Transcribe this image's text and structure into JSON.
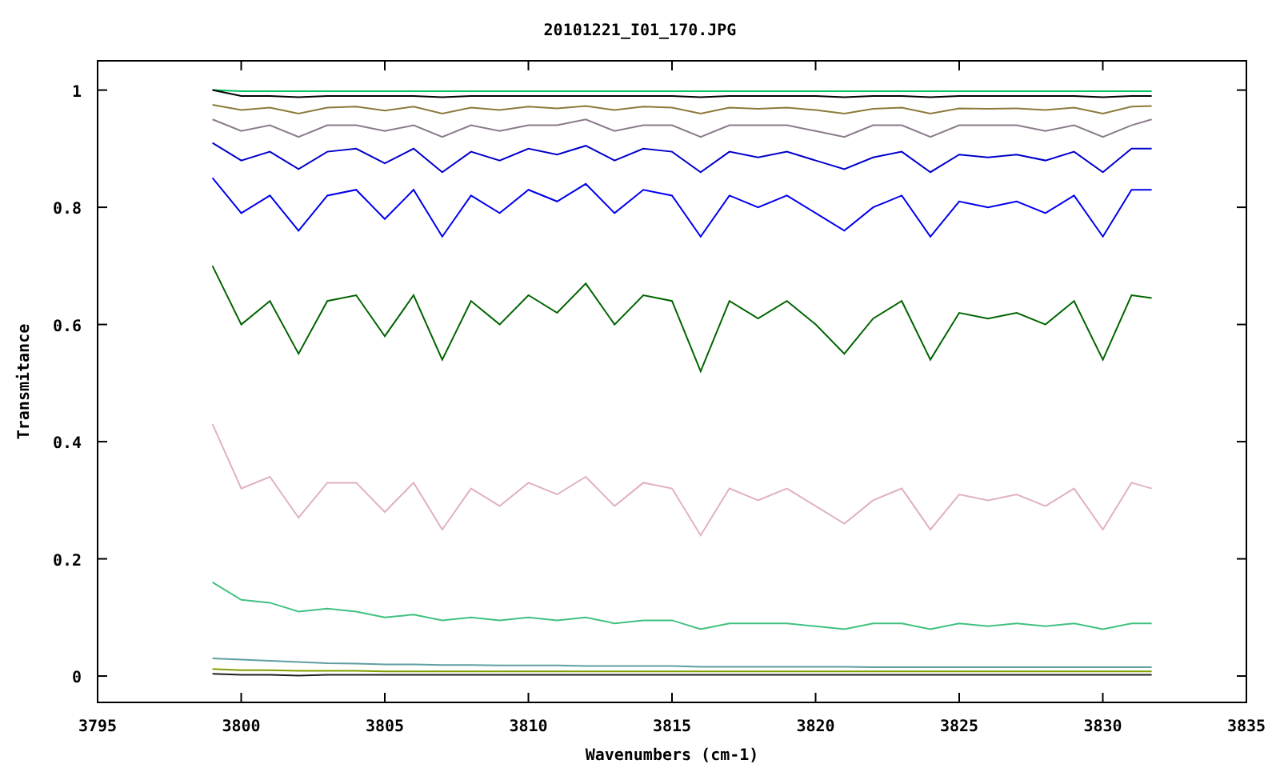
{
  "chart_data": {
    "type": "line",
    "title": "20101221_I01_170.JPG",
    "xlabel": "Wavenumbers (cm-1)",
    "ylabel": "Transmitance",
    "xlim": [
      3795,
      3835
    ],
    "ylim": [
      -0.045,
      1.05
    ],
    "xticks": [
      3795,
      3800,
      3805,
      3810,
      3815,
      3820,
      3825,
      3830,
      3835
    ],
    "yticks": [
      {
        "value": 0,
        "label": "0"
      },
      {
        "value": 0.2,
        "label": "0.2"
      },
      {
        "value": 0.4,
        "label": "0.4"
      },
      {
        "value": 0.6,
        "label": "0.6"
      },
      {
        "value": 0.8,
        "label": "0.8"
      },
      {
        "value": 1,
        "label": "1"
      }
    ],
    "x": [
      3799,
      3800,
      3801,
      3802,
      3803,
      3804,
      3805,
      3806,
      3807,
      3808,
      3809,
      3810,
      3811,
      3812,
      3813,
      3814,
      3815,
      3816,
      3817,
      3818,
      3819,
      3820,
      3821,
      3822,
      3823,
      3824,
      3825,
      3826,
      3827,
      3828,
      3829,
      3830,
      3831,
      3831.7
    ],
    "series": [
      {
        "color": "#00c060",
        "values": [
          1.0,
          0.998,
          0.998,
          0.998,
          0.998,
          0.998,
          0.998,
          0.998,
          0.998,
          0.998,
          0.998,
          0.998,
          0.998,
          0.998,
          0.998,
          0.998,
          0.998,
          0.998,
          0.998,
          0.998,
          0.998,
          0.998,
          0.998,
          0.998,
          0.998,
          0.998,
          0.998,
          0.998,
          0.998,
          0.998,
          0.998,
          0.998,
          0.998,
          0.998
        ]
      },
      {
        "color": "#000000",
        "values": [
          1.0,
          0.99,
          0.99,
          0.988,
          0.99,
          0.99,
          0.99,
          0.99,
          0.988,
          0.99,
          0.99,
          0.99,
          0.99,
          0.99,
          0.99,
          0.99,
          0.99,
          0.988,
          0.99,
          0.99,
          0.99,
          0.99,
          0.988,
          0.99,
          0.99,
          0.988,
          0.99,
          0.99,
          0.99,
          0.99,
          0.99,
          0.988,
          0.99,
          0.99
        ]
      },
      {
        "color": "#8b7a3a",
        "values": [
          0.975,
          0.966,
          0.97,
          0.96,
          0.97,
          0.972,
          0.965,
          0.972,
          0.96,
          0.97,
          0.966,
          0.972,
          0.969,
          0.973,
          0.966,
          0.972,
          0.97,
          0.96,
          0.97,
          0.968,
          0.97,
          0.966,
          0.96,
          0.968,
          0.97,
          0.96,
          0.969,
          0.968,
          0.969,
          0.966,
          0.97,
          0.96,
          0.972,
          0.973
        ]
      },
      {
        "color": "#8a7a8a",
        "values": [
          0.95,
          0.93,
          0.94,
          0.92,
          0.94,
          0.94,
          0.93,
          0.94,
          0.92,
          0.94,
          0.93,
          0.94,
          0.94,
          0.95,
          0.93,
          0.94,
          0.94,
          0.92,
          0.94,
          0.94,
          0.94,
          0.93,
          0.92,
          0.94,
          0.94,
          0.92,
          0.94,
          0.94,
          0.94,
          0.93,
          0.94,
          0.92,
          0.94,
          0.95
        ]
      },
      {
        "color": "#0000cc",
        "values": [
          0.91,
          0.88,
          0.895,
          0.865,
          0.895,
          0.9,
          0.875,
          0.9,
          0.86,
          0.895,
          0.88,
          0.9,
          0.89,
          0.905,
          0.88,
          0.9,
          0.895,
          0.86,
          0.895,
          0.885,
          0.895,
          0.88,
          0.865,
          0.885,
          0.895,
          0.86,
          0.89,
          0.885,
          0.89,
          0.88,
          0.895,
          0.86,
          0.9,
          0.9
        ]
      },
      {
        "color": "#0000ee",
        "values": [
          0.85,
          0.79,
          0.82,
          0.76,
          0.82,
          0.83,
          0.78,
          0.83,
          0.75,
          0.82,
          0.79,
          0.83,
          0.81,
          0.84,
          0.79,
          0.83,
          0.82,
          0.75,
          0.82,
          0.8,
          0.82,
          0.79,
          0.76,
          0.8,
          0.82,
          0.75,
          0.81,
          0.8,
          0.81,
          0.79,
          0.82,
          0.75,
          0.83,
          0.83
        ]
      },
      {
        "color": "#006400",
        "values": [
          0.7,
          0.6,
          0.64,
          0.55,
          0.64,
          0.65,
          0.58,
          0.65,
          0.54,
          0.64,
          0.6,
          0.65,
          0.62,
          0.67,
          0.6,
          0.65,
          0.64,
          0.52,
          0.64,
          0.61,
          0.64,
          0.6,
          0.55,
          0.61,
          0.64,
          0.54,
          0.62,
          0.61,
          0.62,
          0.6,
          0.64,
          0.54,
          0.65,
          0.645
        ]
      },
      {
        "color": "#e0b0c0",
        "values": [
          0.43,
          0.32,
          0.34,
          0.27,
          0.33,
          0.33,
          0.28,
          0.33,
          0.25,
          0.32,
          0.29,
          0.33,
          0.31,
          0.34,
          0.29,
          0.33,
          0.32,
          0.24,
          0.32,
          0.3,
          0.32,
          0.29,
          0.26,
          0.3,
          0.32,
          0.25,
          0.31,
          0.3,
          0.31,
          0.29,
          0.32,
          0.25,
          0.33,
          0.32
        ]
      },
      {
        "color": "#40c080",
        "values": [
          0.16,
          0.13,
          0.125,
          0.11,
          0.115,
          0.11,
          0.1,
          0.105,
          0.095,
          0.1,
          0.095,
          0.1,
          0.095,
          0.1,
          0.09,
          0.095,
          0.095,
          0.08,
          0.09,
          0.09,
          0.09,
          0.085,
          0.08,
          0.09,
          0.09,
          0.08,
          0.09,
          0.085,
          0.09,
          0.085,
          0.09,
          0.08,
          0.09,
          0.09
        ]
      },
      {
        "color": "#5f9ea0",
        "values": [
          0.03,
          0.028,
          0.026,
          0.024,
          0.022,
          0.021,
          0.02,
          0.02,
          0.019,
          0.019,
          0.018,
          0.018,
          0.018,
          0.017,
          0.017,
          0.017,
          0.017,
          0.016,
          0.016,
          0.016,
          0.016,
          0.016,
          0.016,
          0.015,
          0.015,
          0.015,
          0.015,
          0.015,
          0.015,
          0.015,
          0.015,
          0.015,
          0.015,
          0.015
        ]
      },
      {
        "color": "#80a000",
        "values": [
          0.012,
          0.01,
          0.01,
          0.009,
          0.009,
          0.009,
          0.008,
          0.008,
          0.008,
          0.008,
          0.008,
          0.008,
          0.008,
          0.008,
          0.008,
          0.008,
          0.008,
          0.008,
          0.008,
          0.008,
          0.008,
          0.008,
          0.008,
          0.008,
          0.008,
          0.008,
          0.008,
          0.008,
          0.008,
          0.008,
          0.008,
          0.008,
          0.008,
          0.008
        ]
      },
      {
        "color": "#202020",
        "values": [
          0.004,
          0.002,
          0.002,
          0.001,
          0.002,
          0.002,
          0.002,
          0.002,
          0.002,
          0.002,
          0.002,
          0.002,
          0.002,
          0.002,
          0.002,
          0.002,
          0.002,
          0.002,
          0.002,
          0.002,
          0.002,
          0.002,
          0.002,
          0.002,
          0.002,
          0.002,
          0.002,
          0.002,
          0.002,
          0.002,
          0.002,
          0.002,
          0.002,
          0.002
        ]
      }
    ]
  }
}
